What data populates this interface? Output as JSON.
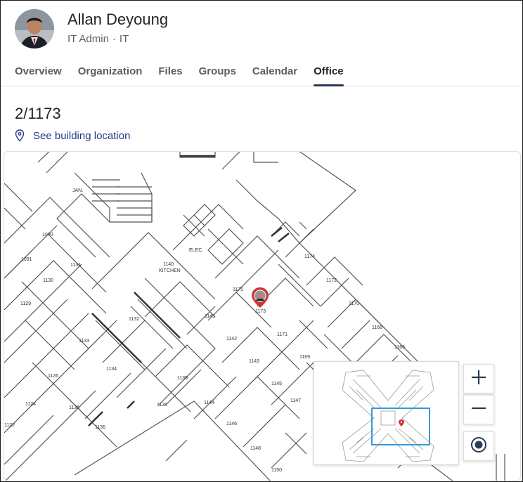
{
  "profile": {
    "name": "Allan Deyoung",
    "role": "IT Admin",
    "separator": "·",
    "department": "IT"
  },
  "tabs": [
    {
      "label": "Overview",
      "active": false
    },
    {
      "label": "Organization",
      "active": false
    },
    {
      "label": "Files",
      "active": false
    },
    {
      "label": "Groups",
      "active": false
    },
    {
      "label": "Calendar",
      "active": false
    },
    {
      "label": "Office",
      "active": true
    }
  ],
  "office": {
    "title": "2/1173",
    "building_link": "See building location"
  },
  "map": {
    "rooms": [
      "JAN.",
      "1090",
      "1091",
      "1131",
      "1130",
      "1129",
      "1140",
      "KITCHEN",
      "ELEC.",
      "1174",
      "1172",
      "1175",
      "1173",
      "1170",
      "1141",
      "1132",
      "1133",
      "1134",
      "1126",
      "1124",
      "1135",
      "1136",
      "1122",
      "1139",
      "1138",
      "1144",
      "1142",
      "1143",
      "1171",
      "1169",
      "1168",
      "1166",
      "1145",
      "1147",
      "1146",
      "1148",
      "1150"
    ],
    "pin_room": "1173",
    "pin_color": "#d13438"
  },
  "controls": {
    "zoom_in_icon": "plus-icon",
    "zoom_out_icon": "minus-icon",
    "locate_icon": "target-icon"
  },
  "colors": {
    "accent": "#2b3a55",
    "link": "#1e3a8a",
    "minimap_viewport": "#1e90d6"
  }
}
